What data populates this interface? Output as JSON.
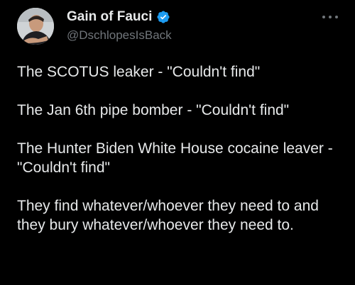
{
  "author": {
    "display_name": "Gain of Fauci",
    "handle": "@DschlopesIsBack",
    "verified": true,
    "verified_color": "#1d9bf0"
  },
  "icons": {
    "verified": "verified-badge-icon",
    "more": "more-options-icon"
  },
  "tweet": {
    "paragraphs": [
      "The SCOTUS leaker - \"Couldn't find\"",
      "The Jan 6th pipe bomber - \"Couldn't find\"",
      "The Hunter Biden White House cocaine leaver - \"Couldn't find\"",
      "They find whatever/whoever they need to and they bury whatever/whoever they need to."
    ]
  },
  "colors": {
    "background": "#000000",
    "text": "#e7e9ea",
    "secondary_text": "#71767b"
  }
}
